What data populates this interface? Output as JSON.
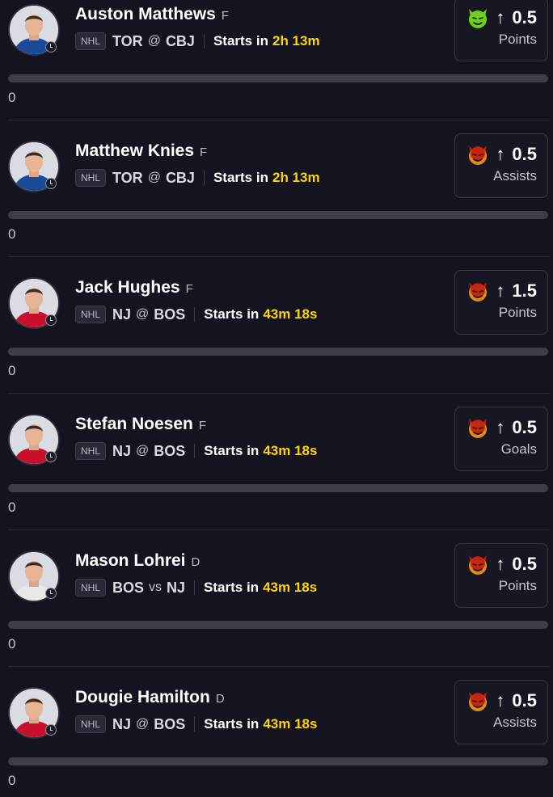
{
  "colors": {
    "background": "#13141f",
    "accent_countdown": "#ffd500",
    "emoji_green": "#6bd117",
    "emoji_red": "#c0150d"
  },
  "cards": [
    {
      "player": "Auston Matthews",
      "position": "F",
      "league": "NHL",
      "team": "TOR",
      "connector": "@",
      "opponent": "CBJ",
      "starts_label": "Starts in",
      "countdown": "2h 13m",
      "line": "0.5",
      "direction": "up",
      "stat": "Points",
      "emoji": "green-devil-icon",
      "progress_value": "0",
      "progress": 0,
      "jersey": "#1b4a9a"
    },
    {
      "player": "Matthew Knies",
      "position": "F",
      "league": "NHL",
      "team": "TOR",
      "connector": "@",
      "opponent": "CBJ",
      "starts_label": "Starts in",
      "countdown": "2h 13m",
      "line": "0.5",
      "direction": "up",
      "stat": "Assists",
      "emoji": "red-devil-icon",
      "progress_value": "0",
      "progress": 0,
      "jersey": "#1b4a9a"
    },
    {
      "player": "Jack Hughes",
      "position": "F",
      "league": "NHL",
      "team": "NJ",
      "connector": "@",
      "opponent": "BOS",
      "starts_label": "Starts in",
      "countdown": "43m 18s",
      "line": "1.5",
      "direction": "up",
      "stat": "Points",
      "emoji": "red-devil-icon",
      "progress_value": "0",
      "progress": 0,
      "jersey": "#c8102e"
    },
    {
      "player": "Stefan Noesen",
      "position": "F",
      "league": "NHL",
      "team": "NJ",
      "connector": "@",
      "opponent": "BOS",
      "starts_label": "Starts in",
      "countdown": "43m 18s",
      "line": "0.5",
      "direction": "up",
      "stat": "Goals",
      "emoji": "red-devil-icon",
      "progress_value": "0",
      "progress": 0,
      "jersey": "#c8102e"
    },
    {
      "player": "Mason Lohrei",
      "position": "D",
      "league": "NHL",
      "team": "BOS",
      "connector": "vs",
      "opponent": "NJ",
      "starts_label": "Starts in",
      "countdown": "43m 18s",
      "line": "0.5",
      "direction": "up",
      "stat": "Points",
      "emoji": "red-devil-icon",
      "progress_value": "0",
      "progress": 0,
      "jersey": "#e8e8e8"
    },
    {
      "player": "Dougie Hamilton",
      "position": "D",
      "league": "NHL",
      "team": "NJ",
      "connector": "@",
      "opponent": "BOS",
      "starts_label": "Starts in",
      "countdown": "43m 18s",
      "line": "0.5",
      "direction": "up",
      "stat": "Assists",
      "emoji": "red-devil-icon",
      "progress_value": "0",
      "progress": 0,
      "jersey": "#c8102e"
    }
  ]
}
